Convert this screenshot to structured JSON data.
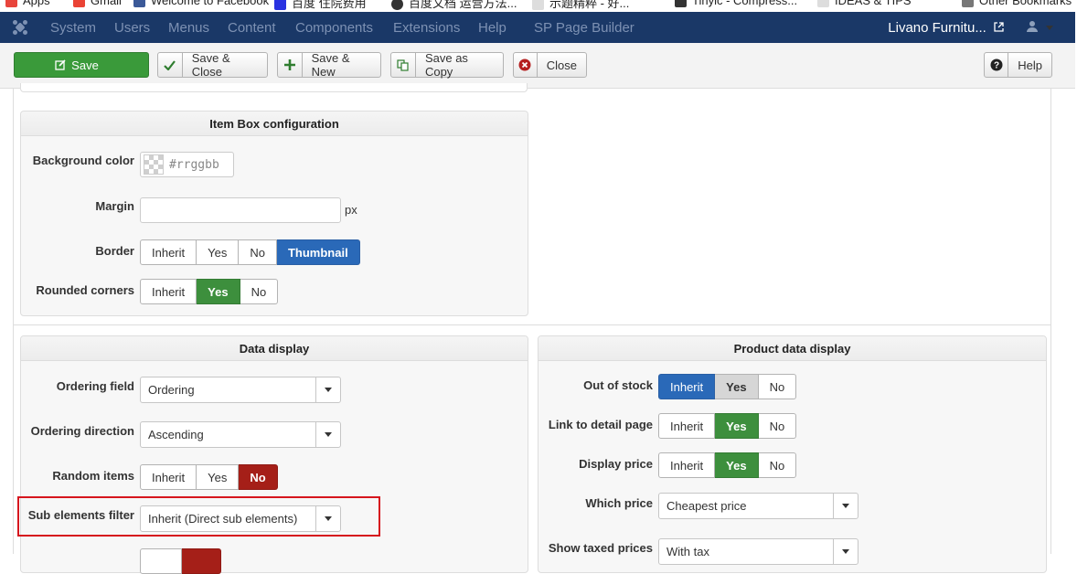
{
  "bookmarks": [
    {
      "label": "Apps",
      "color": "#e8453c"
    },
    {
      "label": "Gmail",
      "color": "#ea4335"
    },
    {
      "label": "Welcome to Facebook",
      "color": "#3b5998"
    },
    {
      "label": "百度 住院费用",
      "color": "#2932e1"
    },
    {
      "label": "百度文档 运营方法...",
      "color": "#333333"
    },
    {
      "label": "示题精粹 - 好...",
      "color": "#dddddd"
    },
    {
      "label": "Tinyic - Compress...",
      "color": "#333333"
    },
    {
      "label": "IDEAS & TIPS",
      "color": "#dddddd"
    },
    {
      "label": "Other Bookmarks",
      "color": "#777777"
    }
  ],
  "navbar": {
    "menu": [
      "System",
      "Users",
      "Menus",
      "Content",
      "Components",
      "Extensions",
      "Help",
      "SP Page Builder"
    ],
    "site_name": "Livano Furnitu...",
    "bg_color": "#1a3867"
  },
  "toolbar": {
    "save": "Save",
    "save_close": "Save & Close",
    "save_new": "Save & New",
    "save_copy": "Save as Copy",
    "close": "Close",
    "help": "Help"
  },
  "item_box": {
    "title": "Item Box configuration",
    "background_color_label": "Background color",
    "background_color_placeholder": "#rrggbb",
    "margin_label": "Margin",
    "margin_value": "",
    "margin_unit": "px",
    "border_label": "Border",
    "border_options": [
      "Inherit",
      "Yes",
      "No",
      "Thumbnail"
    ],
    "border_selected": "Thumbnail",
    "rounded_label": "Rounded corners",
    "rounded_options": [
      "Inherit",
      "Yes",
      "No"
    ],
    "rounded_selected": "Yes"
  },
  "data_display": {
    "title": "Data display",
    "ordering_field_label": "Ordering field",
    "ordering_field_value": "Ordering",
    "ordering_direction_label": "Ordering direction",
    "ordering_direction_value": "Ascending",
    "random_items_label": "Random items",
    "random_options": [
      "Inherit",
      "Yes",
      "No"
    ],
    "random_selected": "No",
    "sub_elements_label": "Sub elements filter",
    "sub_elements_value": "Inherit (Direct sub elements)"
  },
  "product_display": {
    "title": "Product data display",
    "out_of_stock_label": "Out of stock",
    "out_of_stock_options": [
      "Inherit",
      "Yes",
      "No"
    ],
    "out_of_stock_selected": "Inherit",
    "link_detail_label": "Link to detail page",
    "link_detail_options": [
      "Inherit",
      "Yes",
      "No"
    ],
    "link_detail_selected": "Yes",
    "display_price_label": "Display price",
    "display_price_options": [
      "Inherit",
      "Yes",
      "No"
    ],
    "display_price_selected": "Yes",
    "which_price_label": "Which price",
    "which_price_value": "Cheapest price",
    "taxed_label": "Show taxed prices",
    "taxed_value": "With tax"
  }
}
